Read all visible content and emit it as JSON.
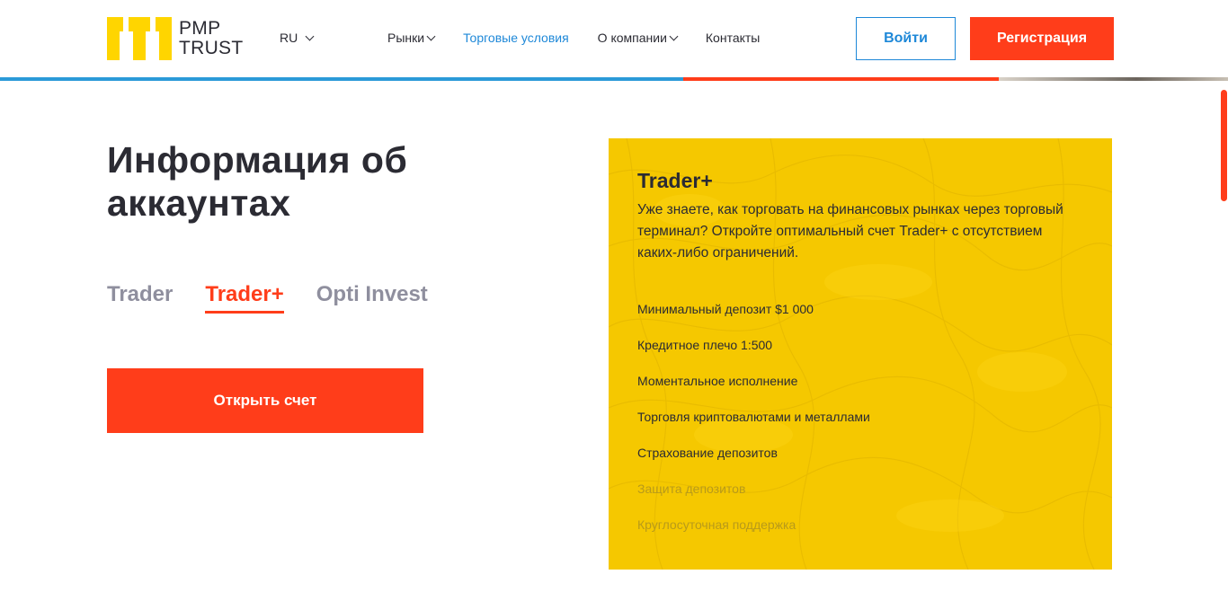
{
  "brand": {
    "logo_line1": "PMP",
    "logo_line2": "TRUST",
    "accent": "#ff3d1a",
    "link_blue": "#1e88d8",
    "card_yellow": "#f5c800"
  },
  "header": {
    "lang": "RU",
    "nav": [
      {
        "label": "Рынки",
        "has_dropdown": true,
        "active": false
      },
      {
        "label": "Торговые условия",
        "has_dropdown": false,
        "active": true
      },
      {
        "label": "О компании",
        "has_dropdown": true,
        "active": false
      },
      {
        "label": "Контакты",
        "has_dropdown": false,
        "active": false
      }
    ],
    "login_label": "Войти",
    "register_label": "Регистрация"
  },
  "main": {
    "title": "Информация об аккаунтах",
    "tabs": [
      {
        "label": "Trader",
        "active": false
      },
      {
        "label": "Trader+",
        "active": true
      },
      {
        "label": "Opti Invest",
        "active": false
      }
    ],
    "open_account_label": "Открыть счет"
  },
  "card": {
    "title": "Trader+",
    "description": "Уже знаете, как торговать на финансовых рынках через торговый терминал? Откройте оптимальный счет Trader+ с отсутствием каких-либо ограничений.",
    "features": [
      {
        "label": "Минимальный депозит $1 000",
        "available": true
      },
      {
        "label": "Кредитное плечо 1:500",
        "available": true
      },
      {
        "label": "Моментальное исполнение",
        "available": true
      },
      {
        "label": "Торговля криптовалютами и металлами",
        "available": true
      },
      {
        "label": "Страхование депозитов",
        "available": true
      },
      {
        "label": "Защита депозитов",
        "available": false
      },
      {
        "label": "Круглосуточная поддержка",
        "available": false
      }
    ]
  }
}
